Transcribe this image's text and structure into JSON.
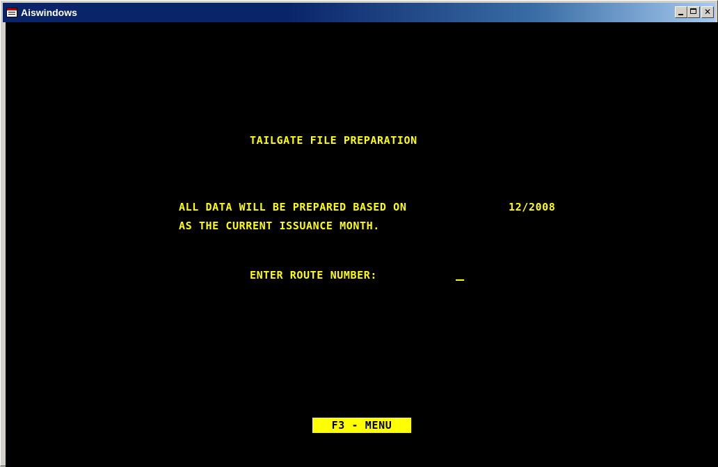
{
  "window": {
    "title": "Aiswindows",
    "minimize_glyph": "_",
    "maximize_glyph": "□",
    "close_glyph": "✕",
    "icon": "window-app-icon"
  },
  "screen": {
    "heading": "TAILGATE FILE PREPARATION",
    "info_line1": "ALL DATA WILL BE PREPARED BASED ON",
    "issuance_month": "12/2008",
    "info_line2": "AS THE CURRENT ISSUANCE MONTH.",
    "route_prompt": "ENTER ROUTE NUMBER:",
    "route_value": ""
  },
  "function_keys": {
    "menu": "F3 - MENU"
  },
  "colors": {
    "terminal_background": "#000000",
    "terminal_text": "#ffff00",
    "titlebar_start": "#0a246a",
    "titlebar_end": "#a6caf0"
  }
}
